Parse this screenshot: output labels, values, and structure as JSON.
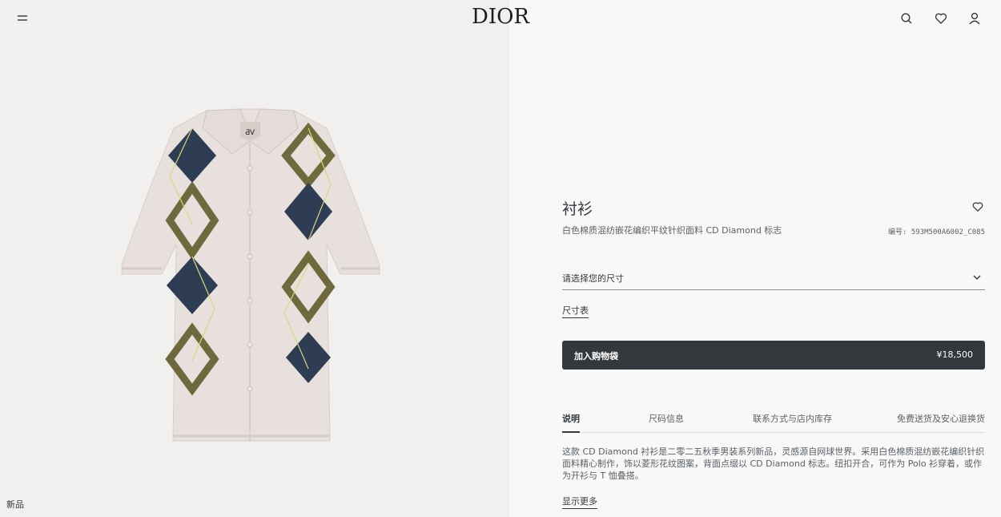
{
  "header": {
    "brand": "DIOR",
    "icons": [
      "menu-icon",
      "search-icon",
      "heart-icon",
      "user-icon"
    ]
  },
  "image_panel": {
    "badge": "新品"
  },
  "product": {
    "title": "衬衫",
    "subtitle": "白色棉质混纺嵌花编织平纹针织面料 CD Diamond 标志",
    "reference": "编号: 593M500A6002_C085",
    "size_select_label": "请选择您的尺寸",
    "size_guide": "尺寸表",
    "add_to_bag": "加入购物袋",
    "price": "¥18,500"
  },
  "tabs": [
    {
      "label": "说明",
      "active": true
    },
    {
      "label": "尺码信息",
      "active": false
    },
    {
      "label": "联系方式与店内库存",
      "active": false
    },
    {
      "label": "免费送货及安心退换货",
      "active": false
    }
  ],
  "description": {
    "text": "这款 CD Diamond 衬衫是二零二五秋季男装系列新品，灵感源自网球世界。采用白色棉质混纺嵌花编织针织面料精心制作，饰以菱形花纹图案，背面点缀以 CD Diamond 标志。纽扣开合，可作为 Polo 衫穿着，或作为开衫与 T 恤叠搭。",
    "show_more": "显示更多"
  },
  "colors": {
    "primary_button": "#33383c",
    "image_bg": "#f1f0ef",
    "page_bg": "#f8f8f8",
    "shirt_base": "#e8e0dc",
    "diamond_navy": "#2e3d54",
    "diamond_olive": "#6e6a3e",
    "diamond_lime": "#d8d878"
  }
}
